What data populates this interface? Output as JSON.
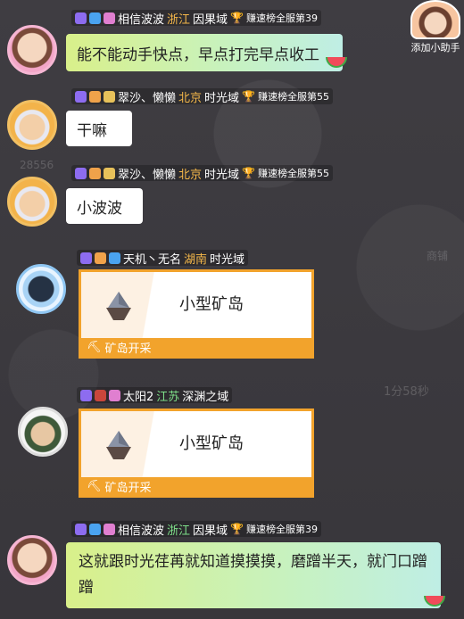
{
  "helper": {
    "label": "添加小助手"
  },
  "background_texts": [
    "28556",
    "1分58秒",
    "商铺"
  ],
  "messages": [
    {
      "kind": "text",
      "avatar": "avatar-pink-hair",
      "name": "相信波波",
      "province": "浙江",
      "server": "因果域",
      "rank": "赚速榜全服第39",
      "text": "能不能动手快点，早点打完早点收工",
      "style": "green"
    },
    {
      "kind": "text",
      "avatar": "avatar-money-guy",
      "name": "翠沙、懒懒",
      "province": "北京",
      "server": "时光域",
      "rank": "赚速榜全服第55",
      "text": "干嘛",
      "style": "white"
    },
    {
      "kind": "text",
      "avatar": "avatar-money-guy",
      "name": "翠沙、懒懒",
      "province": "北京",
      "server": "时光域",
      "rank": "赚速榜全服第55",
      "text": "小波波",
      "style": "white"
    },
    {
      "kind": "card",
      "avatar": "avatar-blue-ring",
      "name": "天机丶无名",
      "province": "湖南",
      "server": "时光域",
      "card_title": "小型矿岛",
      "card_footer": "矿岛开采"
    },
    {
      "kind": "card",
      "avatar": "avatar-soldier",
      "name": "太阳2",
      "province": "江苏",
      "server": "深渊之域",
      "card_title": "小型矿岛",
      "card_footer": "矿岛开采"
    },
    {
      "kind": "text",
      "avatar": "avatar-pink-hair",
      "name": "相信波波",
      "province": "浙江",
      "server": "因果域",
      "rank": "赚速榜全服第39",
      "text": "这就跟时光荏苒就知道摸摸摸，磨蹭半天，就门口蹭蹭",
      "style": "green"
    }
  ],
  "colors": {
    "card_border": "#f2a32c",
    "province": "#f5b84a",
    "background": "#3d3b40"
  }
}
